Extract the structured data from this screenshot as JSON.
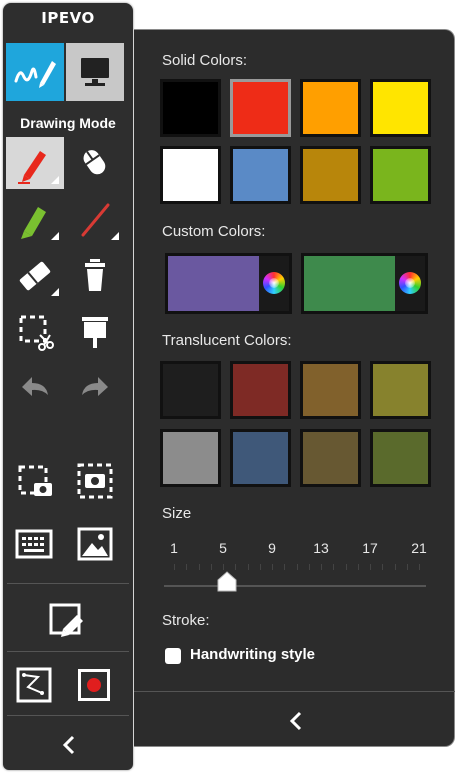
{
  "toolbar": {
    "brand": "IPEVO",
    "mode_label": "Drawing Mode",
    "modes": [
      {
        "name": "drawing-mode",
        "icon": "pen-scribble-icon",
        "active": true
      },
      {
        "name": "desktop-mode",
        "icon": "monitor-icon",
        "active": false
      }
    ],
    "tools": [
      {
        "name": "pen",
        "icon": "pen-icon",
        "selected": true
      },
      {
        "name": "cursor",
        "icon": "mouse-icon"
      },
      {
        "name": "highlighter",
        "icon": "highlighter-icon"
      },
      {
        "name": "line",
        "icon": "line-icon"
      },
      {
        "name": "eraser",
        "icon": "eraser-icon"
      },
      {
        "name": "clear",
        "icon": "trash-icon"
      },
      {
        "name": "cut",
        "icon": "select-cut-icon"
      },
      {
        "name": "board",
        "icon": "whiteboard-icon"
      },
      {
        "name": "undo",
        "icon": "undo-icon"
      },
      {
        "name": "redo",
        "icon": "redo-icon"
      },
      {
        "name": "region-capture",
        "icon": "region-camera-icon"
      },
      {
        "name": "full-capture",
        "icon": "full-camera-icon"
      },
      {
        "name": "keyboard",
        "icon": "keyboard-icon"
      },
      {
        "name": "image",
        "icon": "image-icon"
      },
      {
        "name": "annotate-window",
        "icon": "annotate-window-icon"
      },
      {
        "name": "presentation",
        "icon": "presentation-icon"
      },
      {
        "name": "record",
        "icon": "record-icon"
      }
    ],
    "collapse_icon": "chevron-left-icon"
  },
  "panel": {
    "solid_label": "Solid Colors:",
    "solid_colors": [
      "#000000",
      "#ee2c17",
      "#ff9f00",
      "#ffe500",
      "#ffffff",
      "#5a8ac6",
      "#b8860b",
      "#7ab51d"
    ],
    "selected_solid_index": 1,
    "custom_label": "Custom Colors:",
    "custom_colors": [
      "#6a58a0",
      "#3e8a4c"
    ],
    "custom_icon": "color-wheel-icon",
    "translucent_label": "Translucent Colors:",
    "translucent_colors": [
      "#1e1e1e",
      "#7e2a25",
      "#81612c",
      "#87822d",
      "#8c8c8c",
      "#3f5879",
      "#675832",
      "#5a6a2c"
    ],
    "size_label": "Size",
    "size_values": [
      "1",
      "5",
      "9",
      "13",
      "17",
      "21"
    ],
    "size_selected": "5",
    "stroke_label": "Stroke:",
    "handwriting_label": "Handwriting style",
    "handwriting_checked": false,
    "collapse_icon": "chevron-left-icon"
  }
}
